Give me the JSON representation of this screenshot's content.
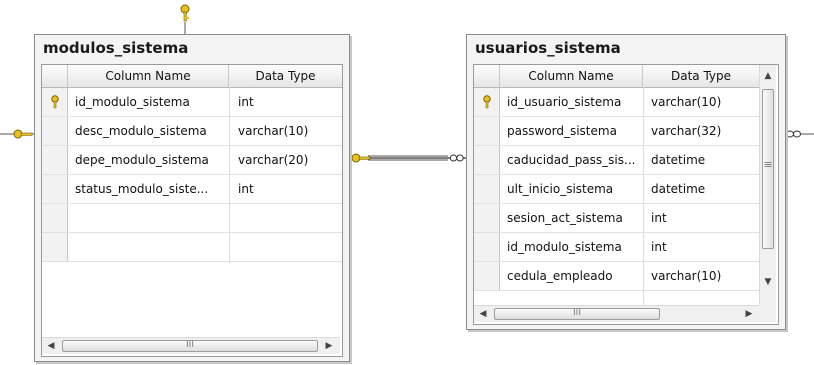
{
  "tables": [
    {
      "name": "modulos_sistema",
      "header": {
        "column_name": "Column Name",
        "data_type": "Data Type"
      },
      "rows": [
        {
          "column": "id_modulo_sistema",
          "type": "int",
          "key": true
        },
        {
          "column": "desc_modulo_sistema",
          "type": "varchar(10)",
          "key": false
        },
        {
          "column": "depe_modulo_sistema",
          "type": "varchar(20)",
          "key": false
        },
        {
          "column": "status_modulo_siste...",
          "type": "int",
          "key": false
        }
      ],
      "hscroll_grip": "III"
    },
    {
      "name": "usuarios_sistema",
      "header": {
        "column_name": "Column Name",
        "data_type": "Data Type"
      },
      "rows": [
        {
          "column": "id_usuario_sistema",
          "type": "varchar(10)",
          "key": true
        },
        {
          "column": "password_sistema",
          "type": "varchar(32)",
          "key": false
        },
        {
          "column": "caducidad_pass_sis...",
          "type": "datetime",
          "key": false
        },
        {
          "column": "ult_inicio_sistema",
          "type": "datetime",
          "key": false
        },
        {
          "column": "sesion_act_sistema",
          "type": "int",
          "key": false
        },
        {
          "column": "id_modulo_sistema",
          "type": "int",
          "key": false
        },
        {
          "column": "cedula_empleado",
          "type": "varchar(10)",
          "key": false
        }
      ],
      "hscroll_grip": "III",
      "vscroll_grip": "≡"
    }
  ],
  "relationship": {
    "from": "modulos_sistema",
    "to": "usuarios_sistema",
    "one_end": "key-icon",
    "many_end": "infinity-icon"
  },
  "icons": {
    "key_color": "#e8c020",
    "line_color": "#555555"
  }
}
